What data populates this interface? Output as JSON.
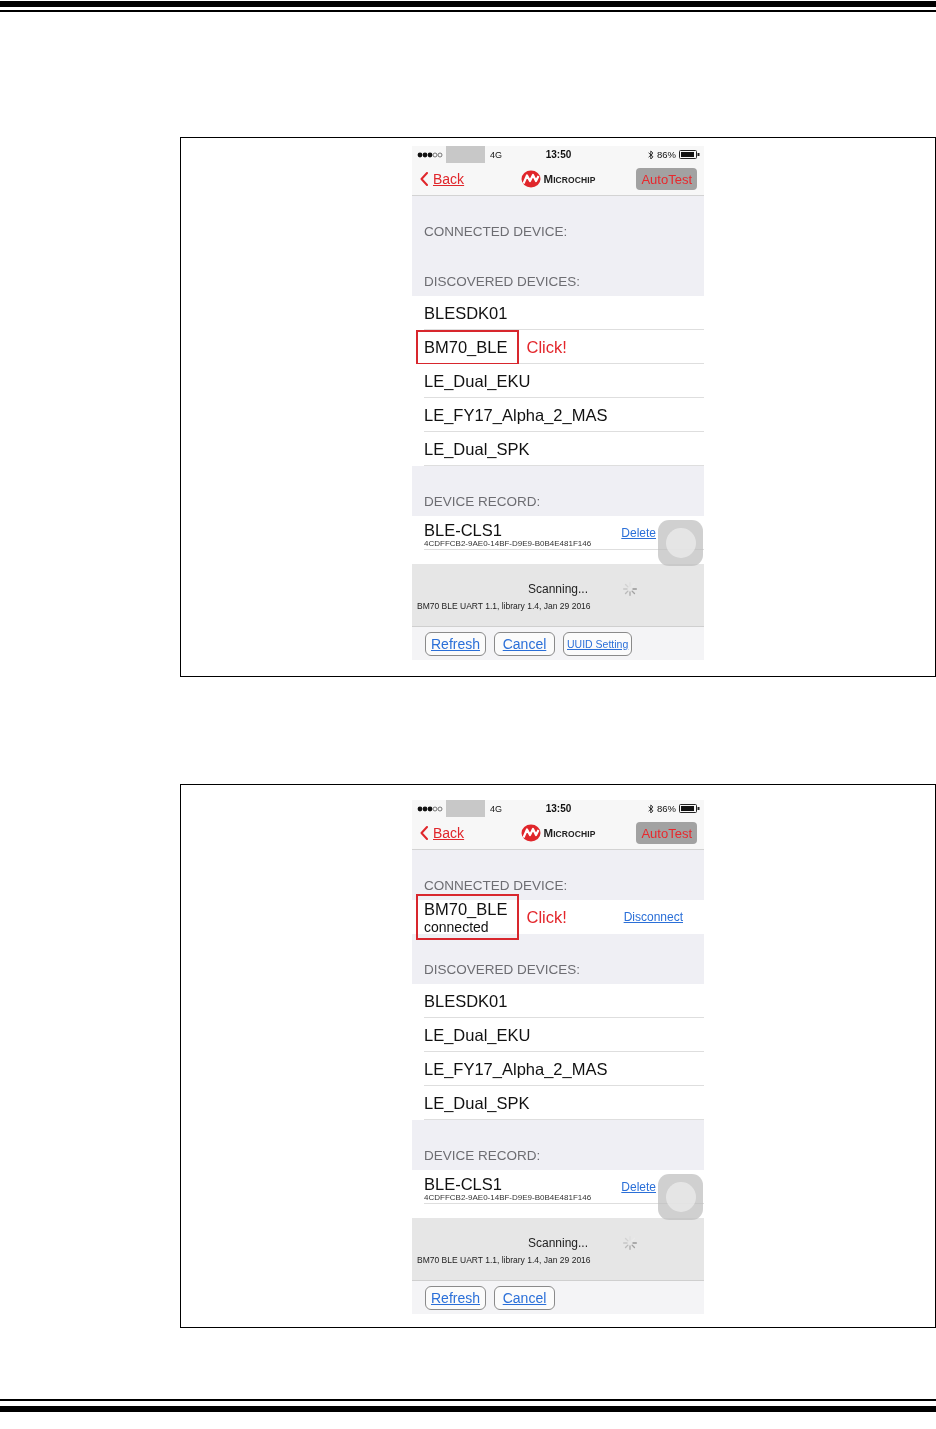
{
  "figures": [
    {
      "status_bar": {
        "network": "4G",
        "time": "13:50",
        "battery": "86%"
      },
      "nav_bar": {
        "back": "Back",
        "logo": "MICROCHIP",
        "button": "AutoTest"
      },
      "connected": {
        "heading": "CONNECTED DEVICE:"
      },
      "discovered": {
        "heading": "DISCOVERED DEVICES:",
        "devices": [
          {
            "name": "BLESDK01",
            "highlighted": false
          },
          {
            "name": "BM70_BLE",
            "highlighted": true,
            "annotation": "Click!"
          },
          {
            "name": "LE_Dual_EKU",
            "highlighted": false
          },
          {
            "name": "LE_FY17_Alpha_2_MAS",
            "highlighted": false
          },
          {
            "name": "LE_Dual_SPK",
            "highlighted": false
          }
        ]
      },
      "records": {
        "heading": "DEVICE RECORD:",
        "items": [
          {
            "name": "BLE-CLS1",
            "uuid": "4CDFFCB2-9AE0-14BF-D9E9-B0B4E481F146",
            "action": "Delete"
          }
        ]
      },
      "scanning": {
        "message": "Scanning...",
        "version": "BM70 BLE UART 1.1, library 1.4, Jan 29 2016"
      },
      "buttons": [
        "Refresh",
        "Cancel",
        "UUID Setting"
      ]
    },
    {
      "status_bar": {
        "network": "4G",
        "time": "13:50",
        "battery": "86%"
      },
      "nav_bar": {
        "back": "Back",
        "logo": "MICROCHIP",
        "button": "AutoTest"
      },
      "connected": {
        "heading": "CONNECTED DEVICE:",
        "devices": [
          {
            "name": "BM70_BLE",
            "status": "connected",
            "highlighted": true,
            "annotation": "Click!",
            "action": "Disconnect"
          }
        ]
      },
      "discovered": {
        "heading": "DISCOVERED DEVICES:",
        "devices": [
          {
            "name": "BLESDK01",
            "highlighted": false
          },
          {
            "name": "LE_Dual_EKU",
            "highlighted": false
          },
          {
            "name": "LE_FY17_Alpha_2_MAS",
            "highlighted": false
          },
          {
            "name": "LE_Dual_SPK",
            "highlighted": false
          }
        ]
      },
      "records": {
        "heading": "DEVICE RECORD:",
        "items": [
          {
            "name": "BLE-CLS1",
            "uuid": "4CDFFCB2-9AE0-14BF-D9E9-B0B4E481F146",
            "action": "Delete"
          }
        ]
      },
      "scanning": {
        "message": "Scanning...",
        "version": "BM70 BLE UART 1.1, library 1.4, Jan 29 2016"
      },
      "buttons": [
        "Refresh",
        "Cancel"
      ]
    }
  ]
}
